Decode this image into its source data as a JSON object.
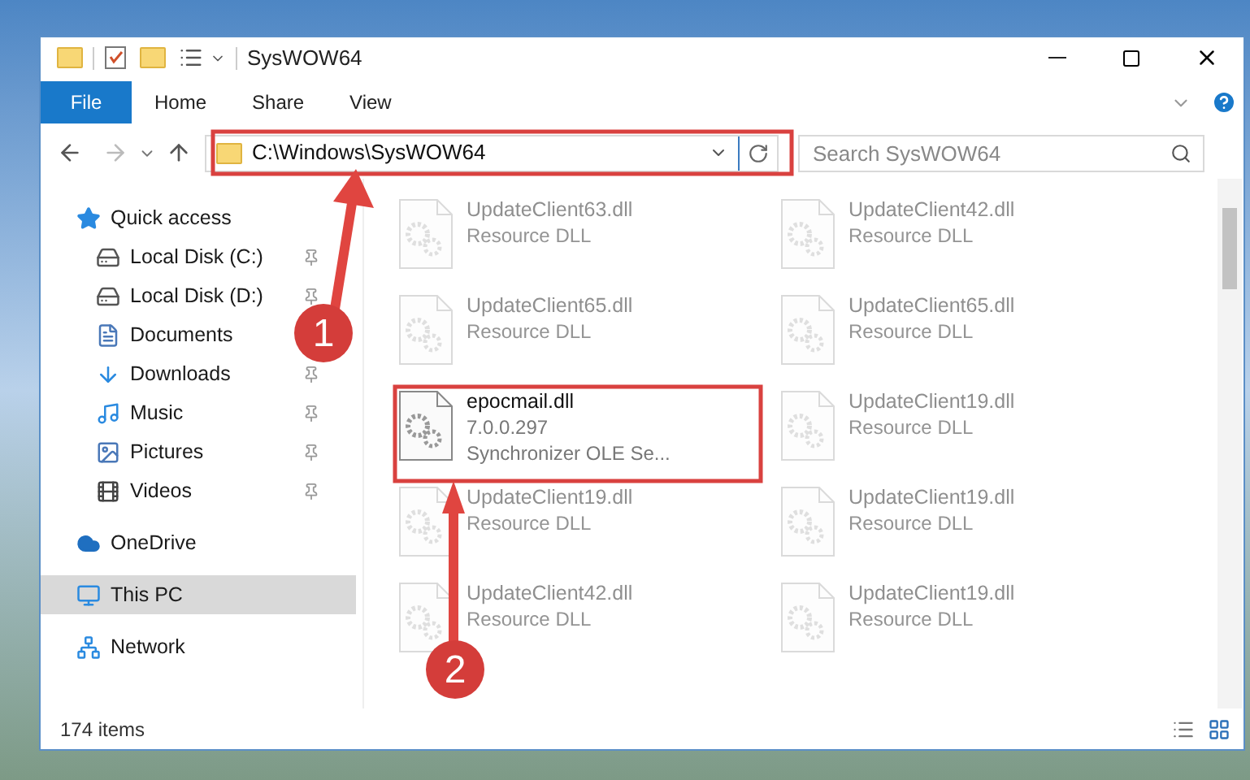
{
  "window": {
    "title": "SysWOW64"
  },
  "ribbon_tabs": [
    {
      "label": "File",
      "kind": "file"
    },
    {
      "label": "Home",
      "kind": "tab"
    },
    {
      "label": "Share",
      "kind": "tab"
    },
    {
      "label": "View",
      "kind": "tab"
    }
  ],
  "address": {
    "path": "C:\\Windows\\SysWOW64"
  },
  "search": {
    "placeholder": "Search SysWOW64"
  },
  "nav": [
    {
      "label": "Quick access",
      "selected": false,
      "children": [
        {
          "label": "Local Disk (C:)",
          "pinned": true,
          "selected": false
        },
        {
          "label": "Local Disk (D:)",
          "pinned": true,
          "selected": false
        },
        {
          "label": "Documents",
          "pinned": false,
          "selected": false
        },
        {
          "label": "Downloads",
          "pinned": true,
          "selected": false
        },
        {
          "label": "Music",
          "pinned": true,
          "selected": false
        },
        {
          "label": "Pictures",
          "pinned": true,
          "selected": false
        },
        {
          "label": "Videos",
          "pinned": true,
          "selected": false
        }
      ]
    },
    {
      "label": "OneDrive",
      "selected": false
    },
    {
      "label": "This PC",
      "selected": true
    },
    {
      "label": "Network",
      "selected": false
    }
  ],
  "files": [
    {
      "name": "UpdateClient63.dll",
      "lines": [
        "Resource DLL"
      ],
      "highlighted": false
    },
    {
      "name": "UpdateClient42.dll",
      "lines": [
        "Resource DLL"
      ],
      "highlighted": false
    },
    {
      "name": "UpdateClient65.dll",
      "lines": [
        "Resource DLL"
      ],
      "highlighted": false
    },
    {
      "name": "UpdateClient65.dll",
      "lines": [
        "Resource DLL"
      ],
      "highlighted": false
    },
    {
      "name": "epocmail.dll",
      "lines": [
        "7.0.0.297",
        "Synchronizer OLE Se..."
      ],
      "highlighted": true
    },
    {
      "name": "UpdateClient19.dll",
      "lines": [
        "Resource DLL"
      ],
      "highlighted": false
    },
    {
      "name": "UpdateClient19.dll",
      "lines": [
        "Resource DLL"
      ],
      "highlighted": false
    },
    {
      "name": "UpdateClient19.dll",
      "lines": [
        "Resource DLL"
      ],
      "highlighted": false
    },
    {
      "name": "UpdateClient42.dll",
      "lines": [
        "Resource DLL"
      ],
      "highlighted": false
    },
    {
      "name": "UpdateClient19.dll",
      "lines": [
        "Resource DLL"
      ],
      "highlighted": false
    }
  ],
  "status_bar": {
    "count": "174 items"
  },
  "annotations": [
    {
      "label": "1"
    },
    {
      "label": "2"
    }
  ]
}
